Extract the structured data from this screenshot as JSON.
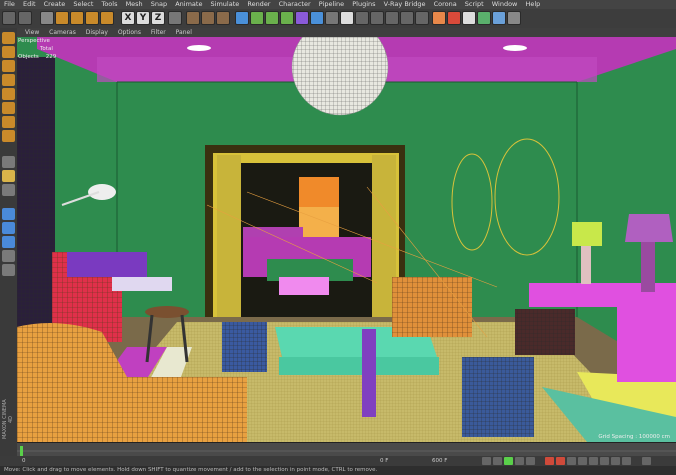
{
  "menu": [
    "File",
    "Edit",
    "Create",
    "Select",
    "Tools",
    "Mesh",
    "Snap",
    "Animate",
    "Simulate",
    "Render",
    "Character",
    "Pipeline",
    "Plugins",
    "V-Ray Bridge",
    "Corona",
    "Script",
    "Window",
    "Help"
  ],
  "toolbar": {
    "axes": [
      "X",
      "Y",
      "Z"
    ]
  },
  "viewport_menu": [
    "View",
    "Cameras",
    "Display",
    "Options",
    "Filter",
    "Panel"
  ],
  "viewport": {
    "camera": "Perspective",
    "stats_label": "Total",
    "objects_label": "Objects",
    "objects_count": "229",
    "grid_spacing": "Grid Spacing : 100000 cm"
  },
  "timeline": {
    "start": "0",
    "end_label": "0 F",
    "frame_field": "600 F"
  },
  "brand": "MAXON CINEMA 4D",
  "status": "Move: Click and drag to move elements. Hold down SHIFT to quantize movement / add to the selection in point mode, CTRL to remove.",
  "colors": {
    "wall": "#2e8c4e",
    "ceiling": "#b13ab0",
    "floor": "#3a2f22",
    "rug": "#c9c06a",
    "accent": "#f4c34a"
  }
}
